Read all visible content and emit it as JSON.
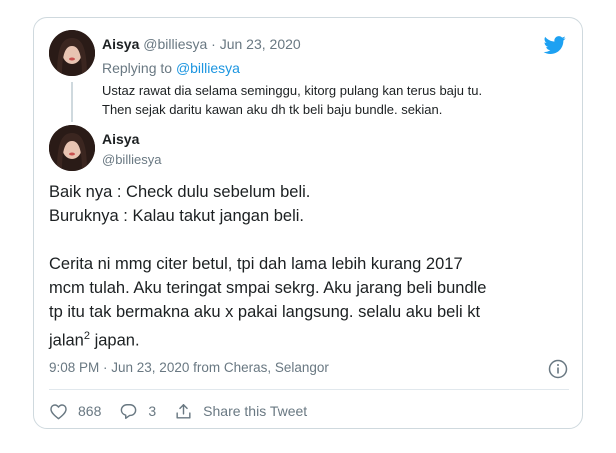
{
  "parent_tweet": {
    "author_name": "Aisya",
    "author_handle": "@billiesya",
    "separator": "·",
    "date": "Jun 23, 2020",
    "replying_prefix": "Replying to",
    "replying_handle": "@billiesya",
    "text_line1": "Ustaz rawat dia selama seminggu, kitorg pulang kan terus baju tu.",
    "text_line2": "Then sejak daritu kawan aku dh tk beli baju bundle. sekian."
  },
  "tweet": {
    "author_name": "Aisya",
    "author_handle": "@billiesya",
    "line1": "Baik nya : Check dulu sebelum beli.",
    "line2": "Buruknya : Kalau takut jangan beli.",
    "para2_line1": "Cerita ni mmg citer betul, tpi dah lama lebih kurang 2017",
    "para2_line2": "mcm tulah. Aku teringat smpai sekrg. Aku jarang beli bundle",
    "para2_line3": "tp itu tak bermakna aku x pakai langsung. selalu aku beli kt",
    "para2_line4_start": "jalan",
    "para2_superscript": "2",
    "para2_line4_end": " japan.",
    "timestamp": "9:08 PM · Jun 23, 2020 from Cheras, Selangor"
  },
  "actions": {
    "like_count": "868",
    "reply_count": "3",
    "share_label": "Share this Tweet"
  },
  "colors": {
    "twitter_blue": "#1da1f2",
    "link_blue": "#1b95e0",
    "muted_gray": "#697882",
    "border": "#cfd9de"
  }
}
